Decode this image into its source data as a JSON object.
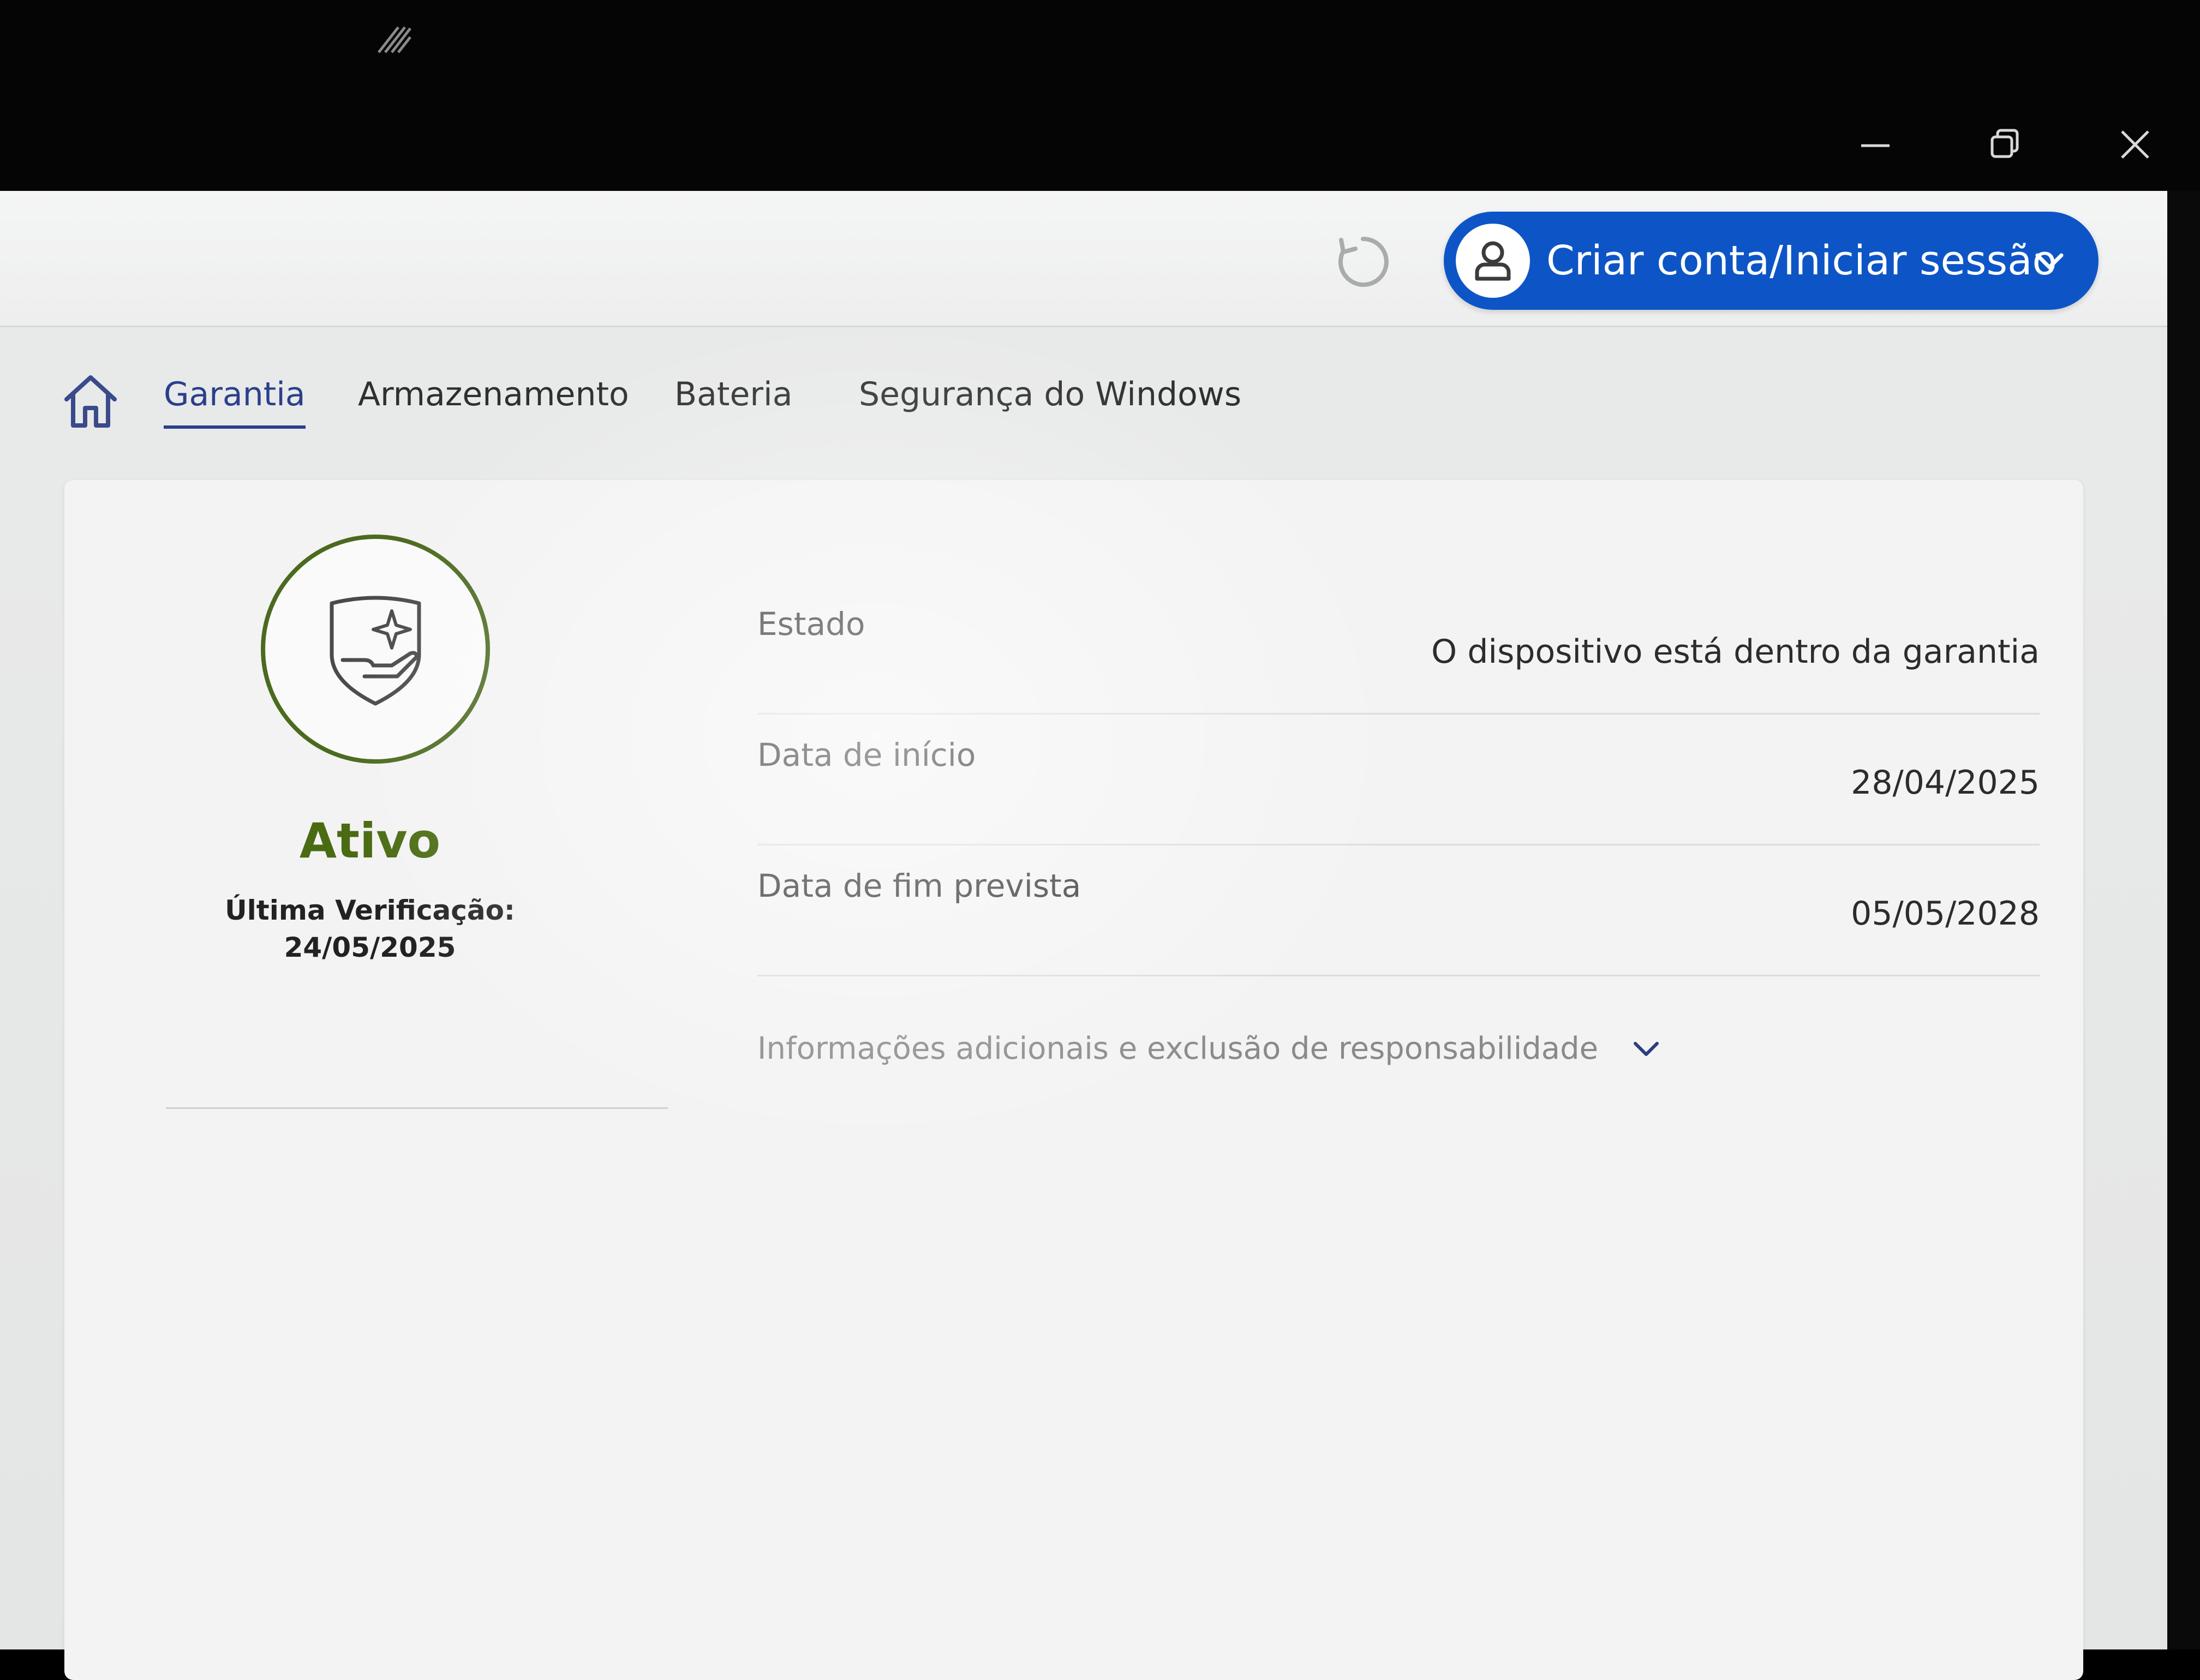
{
  "window": {
    "controls": {
      "minimize": "minimize-icon",
      "restore": "restore-icon",
      "close": "close-icon"
    }
  },
  "header": {
    "account_button_label": "Criar conta/Iniciar sessão",
    "accent_color": "#0d55c6"
  },
  "tabs": [
    {
      "label": "Garantia",
      "active": true
    },
    {
      "label": "Armazenamento",
      "active": false
    },
    {
      "label": "Bateria",
      "active": false
    },
    {
      "label": "Segurança do Windows",
      "active": false
    }
  ],
  "warranty": {
    "status": "Ativo",
    "status_color": "#4a6b12",
    "last_check_label": "Última Verificação:",
    "last_check_date": "24/05/2025",
    "rows": [
      {
        "key": "Estado",
        "value": "O dispositivo está dentro da garantia"
      },
      {
        "key": "Data de início",
        "value": "28/04/2025"
      },
      {
        "key": "Data de fim prevista",
        "value": "05/05/2028"
      }
    ],
    "more_info_label": "Informações adicionais e exclusão de responsabilidade"
  }
}
